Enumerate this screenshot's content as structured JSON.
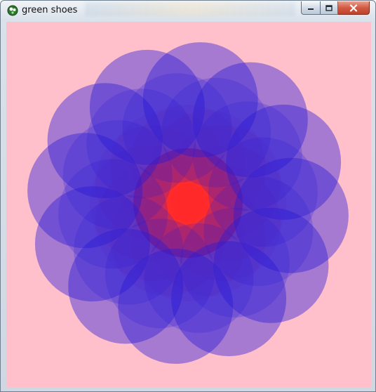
{
  "window": {
    "title": "green shoes",
    "app_icon": "green-shoes-icon",
    "controls": {
      "minimize_icon": "minimize-icon",
      "maximize_icon": "maximize-icon",
      "close_icon": "close-icon"
    }
  },
  "canvas": {
    "background": "#ffc0cb",
    "center_color": "#ff2a2a",
    "circle_color": "#2a1bd6",
    "circle_count": 12
  }
}
